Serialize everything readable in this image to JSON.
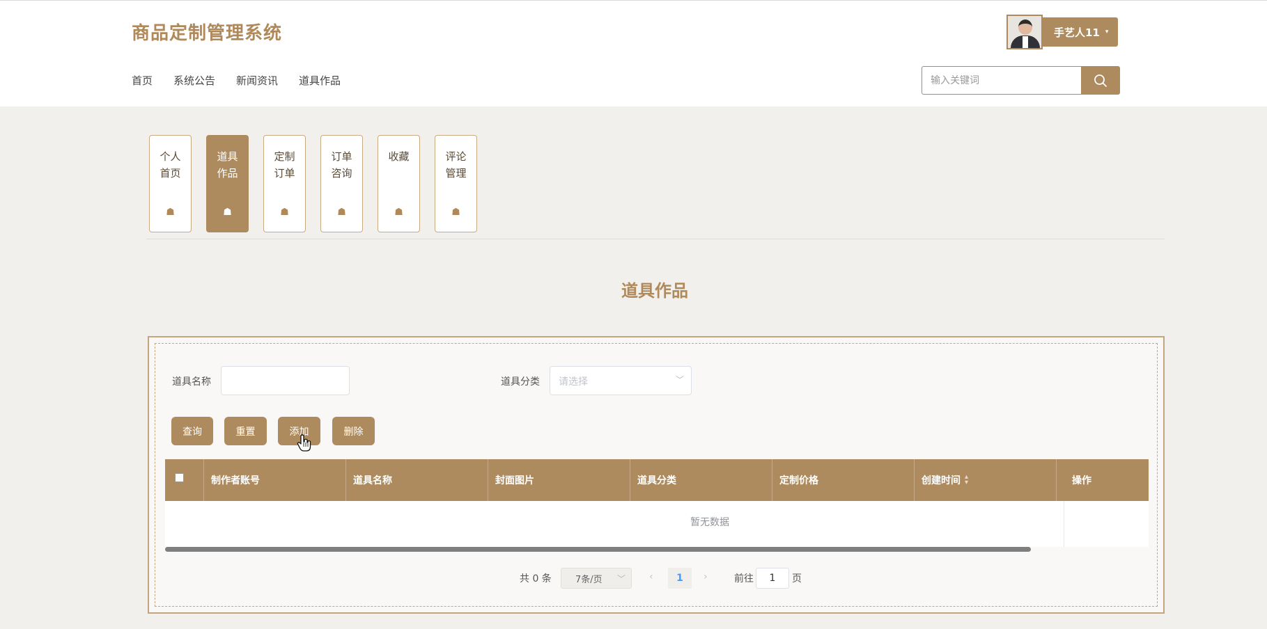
{
  "header": {
    "site_title": "商品定制管理系统",
    "nav": [
      "首页",
      "系统公告",
      "新闻资讯",
      "道具作品"
    ],
    "user": {
      "name": "手艺人11",
      "caret": "▾"
    },
    "search": {
      "placeholder": "输入关键词"
    }
  },
  "tabs": [
    {
      "label": "个人首页",
      "active": false
    },
    {
      "label": "道具作品",
      "active": true
    },
    {
      "label": "定制订单",
      "active": false
    },
    {
      "label": "订单咨询",
      "active": false
    },
    {
      "label": "收藏",
      "active": false
    },
    {
      "label": "评论管理",
      "active": false
    }
  ],
  "tab_icon": "☗",
  "page_title": "道具作品",
  "filters": {
    "name_label": "道具名称",
    "name_value": "",
    "category_label": "道具分类",
    "category_placeholder": "请选择"
  },
  "buttons": {
    "query": "查询",
    "reset": "重置",
    "add": "添加",
    "delete": "删除"
  },
  "table": {
    "columns": [
      "制作者账号",
      "道具名称",
      "封面图片",
      "道具分类",
      "定制价格",
      "创建时间",
      "操作"
    ],
    "empty_text": "暂无数据"
  },
  "pagination": {
    "total_text": "共 0 条",
    "page_size": "7条/页",
    "current_page": "1",
    "goto_label": "前往",
    "goto_value": "1",
    "page_unit": "页",
    "prev": "‹",
    "next": "›"
  },
  "colors": {
    "accent": "#ad8b5e",
    "page_bg": "#f2f0ed"
  }
}
